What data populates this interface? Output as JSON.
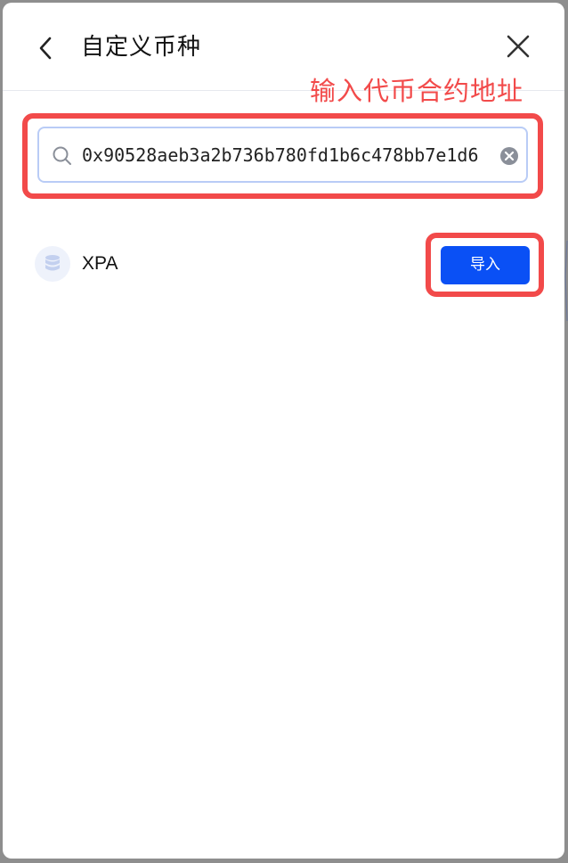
{
  "header": {
    "title": "自定义币种",
    "back_icon": "chevron-left-icon",
    "close_icon": "close-icon"
  },
  "annotation": {
    "text": "输入代币合约地址",
    "color": "#f24a4a"
  },
  "search": {
    "value": "0x90528aeb3a2b736b780fd1b6c478bb7e1d6",
    "icon": "search-icon",
    "clear_icon": "clear-circle-icon"
  },
  "token": {
    "icon": "coin-stack-icon",
    "name": "XPA",
    "import_label": "导入"
  },
  "colors": {
    "accent": "#0a50f5",
    "highlight": "#f24a4a",
    "search_border": "#b9ccf6"
  }
}
